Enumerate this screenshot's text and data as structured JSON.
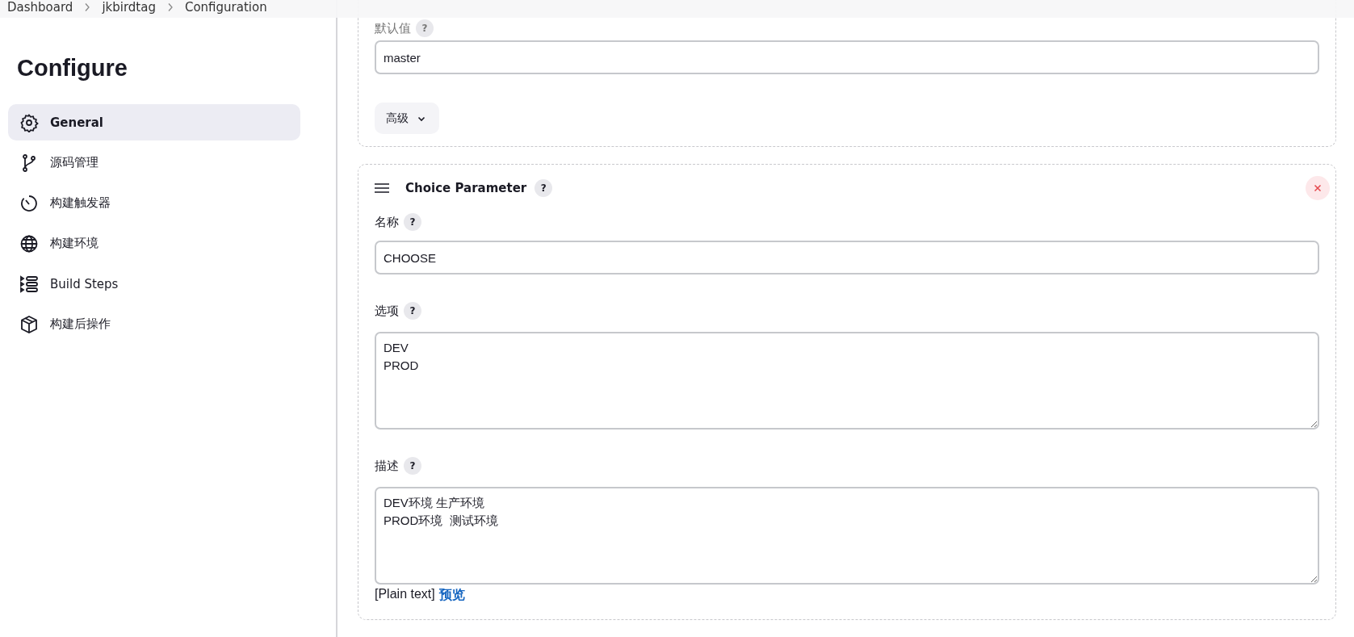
{
  "breadcrumbs": [
    {
      "label": "Dashboard"
    },
    {
      "label": "jkbirdtag"
    },
    {
      "label": "Configuration"
    }
  ],
  "sidebar": {
    "title": "Configure",
    "items": [
      {
        "label": "General",
        "selected": true
      },
      {
        "label": "源码管理",
        "selected": false
      },
      {
        "label": "构建触发器",
        "selected": false
      },
      {
        "label": "构建环境",
        "selected": false
      },
      {
        "label": "Build Steps",
        "selected": false
      },
      {
        "label": "构建后操作",
        "selected": false
      }
    ]
  },
  "default_value": {
    "label": "默认值",
    "help": "?",
    "value": "master",
    "advanced_button": "高级"
  },
  "choice_parameter": {
    "title": "Choice Parameter",
    "help": "?",
    "fields": [
      {
        "kind": "input",
        "label": "名称",
        "help": "?",
        "value": "CHOOSE"
      },
      {
        "kind": "textarea",
        "label": "选项",
        "help": "?",
        "value": "DEV\nPROD"
      },
      {
        "kind": "textarea",
        "label": "描述",
        "help": "?",
        "value": "DEV环境 生产环境\nPROD环境  测试环境"
      }
    ],
    "format": "[Plain text]",
    "preview_link": "预览"
  }
}
